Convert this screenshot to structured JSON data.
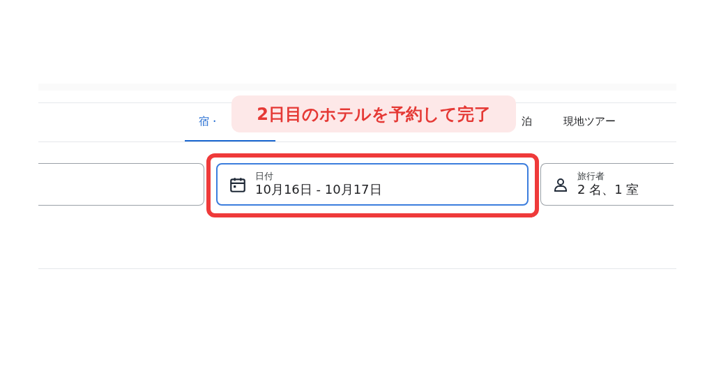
{
  "tabs": [
    {
      "label": "宿・",
      "selected": true
    },
    {
      "label": "泊",
      "selected": false
    },
    {
      "label": "現地ツアー",
      "selected": false
    }
  ],
  "fields": [
    {
      "kind": "blank"
    },
    {
      "kind": "date",
      "label": "日付",
      "value": "10月16日 - 10月17日",
      "selected": true
    },
    {
      "kind": "travelers",
      "label": "旅行者",
      "value": "2 名、1 室",
      "selected": false
    }
  ],
  "callout": {
    "text": "2日目のホテルを予約して完了"
  }
}
